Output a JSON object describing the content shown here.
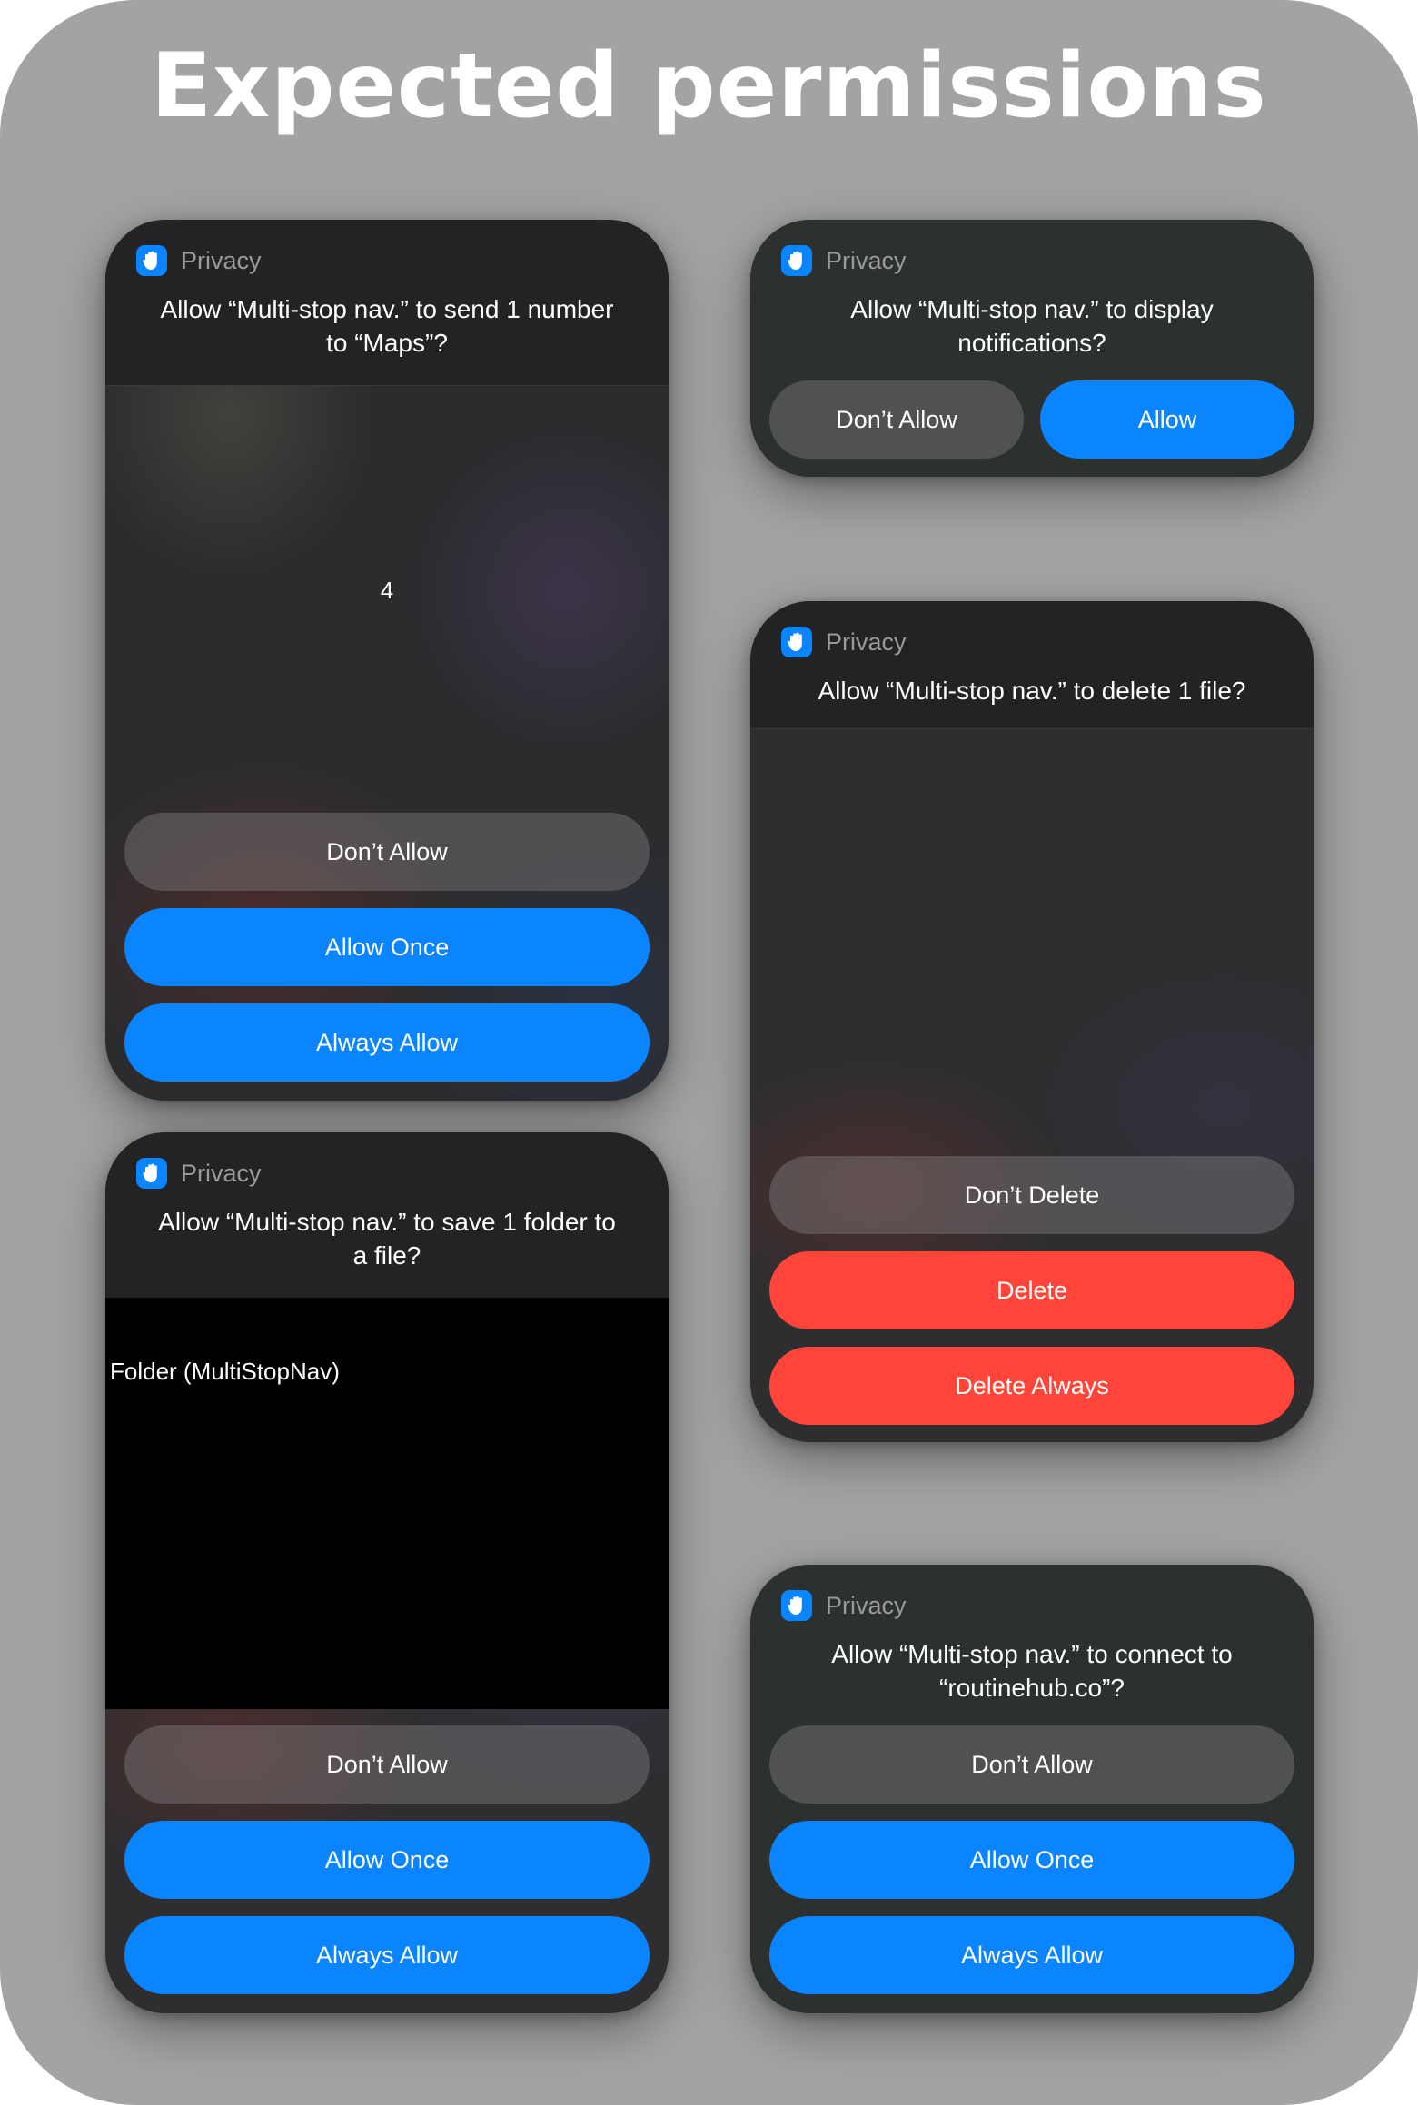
{
  "title": "Expected permissions",
  "colors": {
    "background": "#a3a3a3",
    "accent_blue": "#0a84ff",
    "destructive_red": "#ff453a",
    "card_header": "#232323"
  },
  "icons": {
    "privacy": "raised-hand-icon"
  },
  "cards": {
    "send_number": {
      "header": "Privacy",
      "question": "Allow “Multi-stop nav.” to send 1 number\nto “Maps”?",
      "content": "4",
      "buttons": [
        "Don’t Allow",
        "Allow Once",
        "Always Allow"
      ]
    },
    "notifications": {
      "header": "Privacy",
      "question": "Allow “Multi-stop nav.” to display\nnotifications?",
      "buttons": [
        "Don’t Allow",
        "Allow"
      ]
    },
    "delete_file": {
      "header": "Privacy",
      "question": "Allow “Multi-stop nav.” to delete 1 file?",
      "buttons": [
        "Don’t Delete",
        "Delete",
        "Delete Always"
      ]
    },
    "save_folder": {
      "header": "Privacy",
      "question": "Allow “Multi-stop nav.” to save 1 folder to\na file?",
      "content": "Folder (MultiStopNav)",
      "buttons": [
        "Don’t Allow",
        "Allow Once",
        "Always Allow"
      ]
    },
    "connect": {
      "header": "Privacy",
      "question": "Allow “Multi-stop nav.” to connect to\n“routinehub.co”?",
      "buttons": [
        "Don’t Allow",
        "Allow Once",
        "Always Allow"
      ]
    }
  }
}
